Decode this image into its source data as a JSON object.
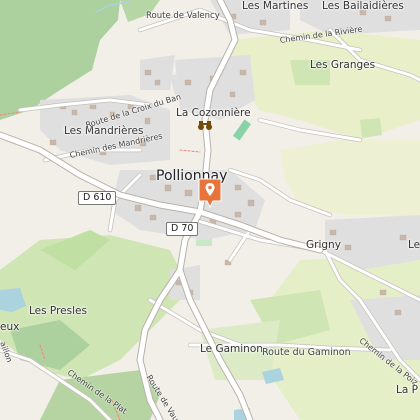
{
  "map": {
    "places": {
      "pollionnay": "Pollionnay",
      "la_cozonniere": "La Cozonnière",
      "les_mandrieres": "Les Mandrières",
      "les_martines": "Les Martines",
      "les_bailaidieres": "Les Bailaidières",
      "les_granges": "Les Granges",
      "grigny": "Grigny",
      "les_presles": "Les Presles",
      "le_gaminon": "Le Gaminon",
      "le_cut_right": "Le",
      "la_p_cut": "La P",
      "eux_cut": "eux"
    },
    "roads": {
      "route_de_valency": "Route de Valency",
      "chemin_de_la_riviere": "Chemin de la Rivière",
      "route_croix_du_ban": "Route de la Croix du Ban",
      "chemin_des_mandrieres": "Chemin des Mandrières",
      "route_du_gaminon": "Route du Gaminon",
      "chemin_de_la_poiz": "Chemin de la Poiz",
      "route_de_vaugn": "Route de Vaugn",
      "chemin_de_la_plat": "Chemin de la Plat",
      "aillon_cut": "aillon"
    },
    "shields": {
      "d610": "D 610",
      "d70": "D 70"
    },
    "marker": {
      "icon": "map-pin-icon",
      "color": "#e8743b"
    },
    "poi": {
      "icon": "binoculars-icon"
    }
  }
}
